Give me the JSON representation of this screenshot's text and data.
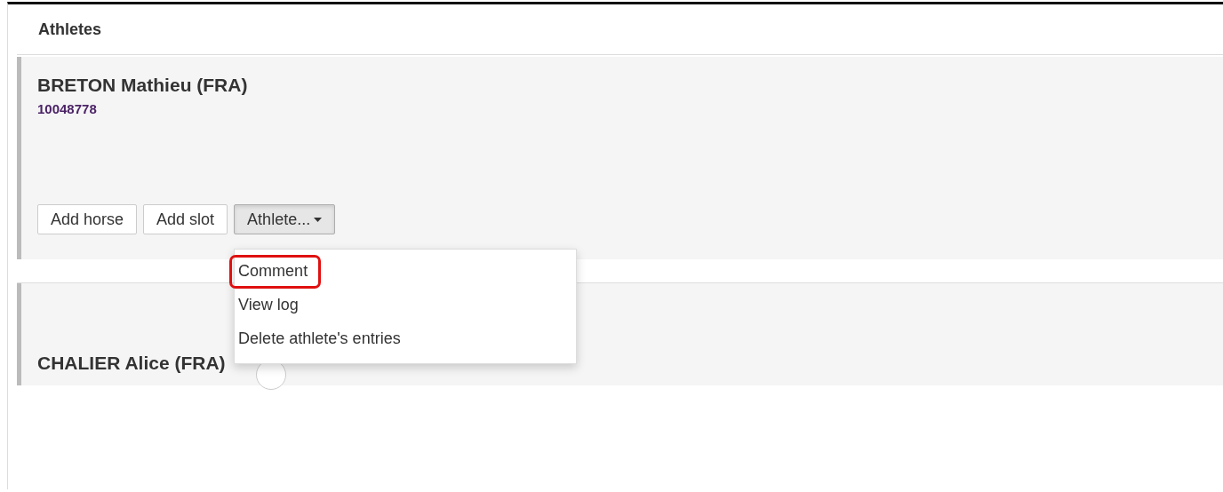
{
  "section_title": "Athletes",
  "athletes": [
    {
      "name": "BRETON Mathieu (FRA)",
      "id_number": "10048778",
      "buttons": [
        "Add horse",
        "Add slot"
      ],
      "dropdown": {
        "label": "Athlete...",
        "open": true,
        "items": [
          {
            "label": "Comment",
            "highlighted": true
          },
          {
            "label": "View log",
            "highlighted": false
          },
          {
            "label": "Delete athlete's entries",
            "highlighted": false
          }
        ]
      }
    },
    {
      "name": "CHALIER Alice (FRA)"
    }
  ]
}
